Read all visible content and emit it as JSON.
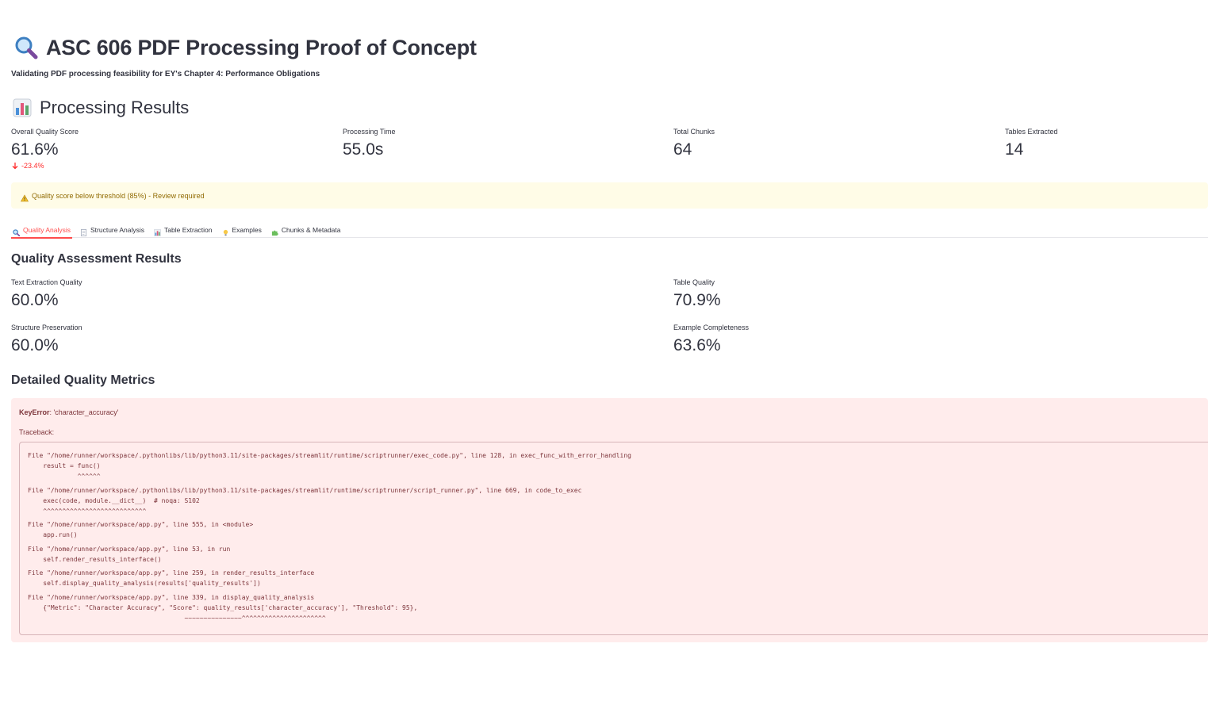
{
  "header": {
    "title": "ASC 606 PDF Processing Proof of Concept",
    "title_icon": "magnifier-icon",
    "subtitle": "Validating PDF processing feasibility for EY's Chapter 4: Performance Obligations"
  },
  "results": {
    "heading": "Processing Results",
    "heading_icon": "bar-chart-icon",
    "metrics": [
      {
        "label": "Overall Quality Score",
        "value": "61.6%",
        "delta": "-23.4%"
      },
      {
        "label": "Processing Time",
        "value": "55.0s"
      },
      {
        "label": "Total Chunks",
        "value": "64"
      },
      {
        "label": "Tables Extracted",
        "value": "14"
      }
    ],
    "warning": "Quality score below threshold (85%) - Review required"
  },
  "tabs": [
    {
      "label": "Quality Analysis",
      "icon": "magnifier-icon",
      "active": true
    },
    {
      "label": "Structure Analysis",
      "icon": "document-icon"
    },
    {
      "label": "Table Extraction",
      "icon": "bar-chart-icon"
    },
    {
      "label": "Examples",
      "icon": "lightbulb-icon"
    },
    {
      "label": "Chunks & Metadata",
      "icon": "puzzle-icon"
    }
  ],
  "quality": {
    "heading": "Quality Assessment Results",
    "metrics": [
      {
        "label": "Text Extraction Quality",
        "value": "60.0%"
      },
      {
        "label": "Table Quality",
        "value": "70.9%"
      },
      {
        "label": "Structure Preservation",
        "value": "60.0%"
      },
      {
        "label": "Example Completeness",
        "value": "63.6%"
      }
    ],
    "detail_heading": "Detailed Quality Metrics"
  },
  "error": {
    "type": "KeyError",
    "message": ": 'character_accuracy'",
    "traceback_label": "Traceback:",
    "frames": [
      [
        "File \"/home/runner/workspace/.pythonlibs/lib/python3.11/site-packages/streamlit/runtime/scriptrunner/exec_code.py\", line 128, in exec_func_with_error_handling",
        "    result = func()",
        "             ^^^^^^"
      ],
      [
        "File \"/home/runner/workspace/.pythonlibs/lib/python3.11/site-packages/streamlit/runtime/scriptrunner/script_runner.py\", line 669, in code_to_exec",
        "    exec(code, module.__dict__)  # noqa: S102",
        "    ^^^^^^^^^^^^^^^^^^^^^^^^^^^"
      ],
      [
        "File \"/home/runner/workspace/app.py\", line 555, in <module>",
        "    app.run()"
      ],
      [
        "File \"/home/runner/workspace/app.py\", line 53, in run",
        "    self.render_results_interface()"
      ],
      [
        "File \"/home/runner/workspace/app.py\", line 259, in render_results_interface",
        "    self.display_quality_analysis(results['quality_results'])"
      ],
      [
        "File \"/home/runner/workspace/app.py\", line 339, in display_quality_analysis",
        "    {\"Metric\": \"Character Accuracy\", \"Score\": quality_results['character_accuracy'], \"Threshold\": 95},",
        "                                         ~~~~~~~~~~~~~~~^^^^^^^^^^^^^^^^^^^^^^"
      ]
    ]
  },
  "colors": {
    "accent": "#ff4b4b",
    "delta_negative": "#ff2b2b",
    "warning_bg": "#fffce7",
    "warning_text": "#926c05",
    "error_bg": "#ffecec",
    "error_text": "#7d353b"
  }
}
